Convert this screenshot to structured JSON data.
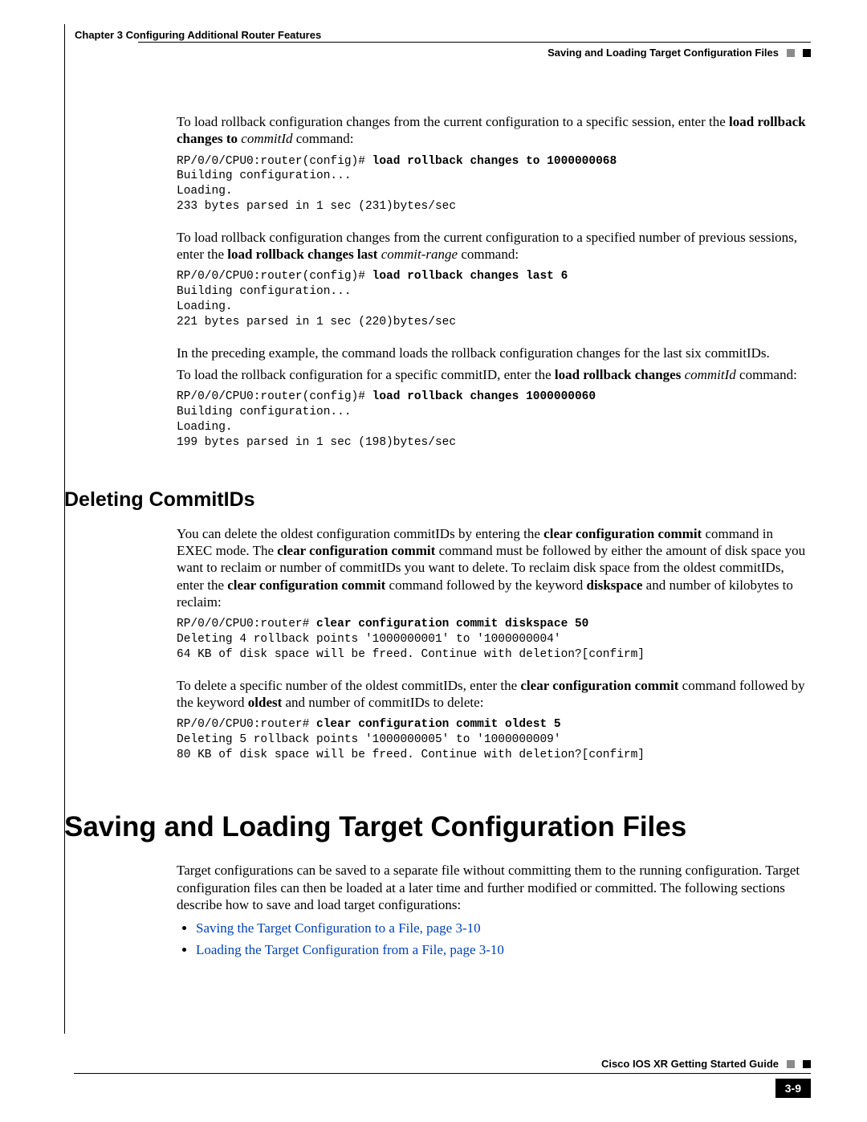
{
  "header": {
    "chapter": "Chapter 3    Configuring Additional Router Features",
    "section": "Saving and Loading Target Configuration Files"
  },
  "body": {
    "p1a": "To load rollback configuration changes from the current configuration to a specific session, enter the ",
    "p1b": "load rollback changes to",
    "p1c": "commitId",
    "p1d": " command:",
    "code1_prompt": "RP/0/0/CPU0:router(config)# ",
    "code1_cmd": "load rollback changes to 1000000068",
    "code1_rest": "Building configuration...\nLoading.\n233 bytes parsed in 1 sec (231)bytes/sec",
    "p2a": "To load rollback configuration changes from the current configuration to a specified number of previous sessions, enter the ",
    "p2b": "load rollback changes last",
    "p2c": "commit-range",
    "p2d": " command:",
    "code2_prompt": "RP/0/0/CPU0:router(config)# ",
    "code2_cmd": "load rollback changes last 6",
    "code2_rest": "Building configuration...\nLoading.\n221 bytes parsed in 1 sec (220)bytes/sec",
    "p3": "In the preceding example, the command loads the rollback configuration changes for the last six commitIDs.",
    "p4a": "To load the rollback configuration for a specific commitID, enter the ",
    "p4b": "load rollback changes",
    "p4c": "commitId",
    "p4d": " command:",
    "code3_prompt": "RP/0/0/CPU0:router(config)# ",
    "code3_cmd": "load rollback changes 1000000060",
    "code3_rest": "Building configuration...\nLoading.\n199 bytes parsed in 1 sec (198)bytes/sec",
    "h2": "Deleting CommitIDs",
    "p5a": "You can delete the oldest configuration commitIDs by entering the ",
    "p5b": "clear configuration commit",
    "p5c": " command in EXEC mode. The ",
    "p5d": "clear configuration commit",
    "p5e": " command must be followed by either the amount of disk space you want to reclaim or number of commitIDs you want to delete. To reclaim disk space from the oldest commitIDs, enter the ",
    "p5f": "clear configuration commit",
    "p5g": " command followed by the keyword ",
    "p5h": "diskspace",
    "p5i": " and number of kilobytes to reclaim:",
    "code4_prompt": "RP/0/0/CPU0:router# ",
    "code4_cmd": "clear configuration commit diskspace 50",
    "code4_rest": "Deleting 4 rollback points '1000000001' to '1000000004'\n64 KB of disk space will be freed. Continue with deletion?[confirm]",
    "p6a": "To delete a specific number of the oldest commitIDs, enter the ",
    "p6b": "clear configuration commit",
    "p6c": " command followed by the keyword ",
    "p6d": "oldest",
    "p6e": " and number of commitIDs to delete:",
    "code5_prompt": "RP/0/0/CPU0:router# ",
    "code5_cmd": "clear configuration commit oldest 5",
    "code5_rest": "Deleting 5 rollback points '1000000005' to '1000000009'\n80 KB of disk space will be freed. Continue with deletion?[confirm]",
    "h1": "Saving and Loading Target Configuration Files",
    "p7": "Target configurations can be saved to a separate file without committing them to the running configuration. Target configuration files can then be loaded at a later time and further modified or committed. The following sections describe how to save and load target configurations:",
    "link1": "Saving the Target Configuration to a File, page 3-10",
    "link2": "Loading the Target Configuration from a File, page 3-10"
  },
  "footer": {
    "guide": "Cisco IOS XR Getting Started Guide",
    "pagenum": "3-9"
  }
}
